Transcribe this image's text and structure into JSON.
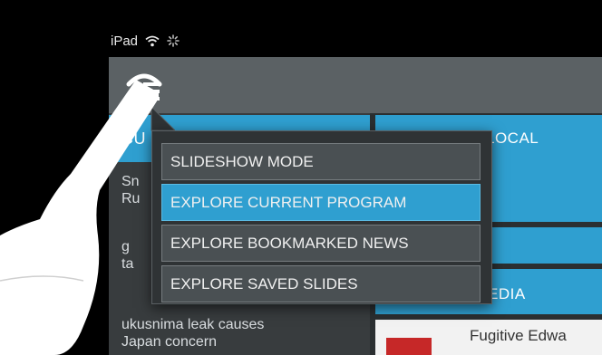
{
  "status_bar": {
    "device_label": "iPad",
    "icons": [
      "wifi-icon",
      "activity-spinner-icon"
    ]
  },
  "top_bar": {
    "menu_icon": "menu-icon"
  },
  "left_panel": {
    "tab_label": "CU",
    "news_items": [
      {
        "line1": "Sn",
        "line2": "Ru"
      },
      {
        "line1": "g",
        "line2": "ta"
      },
      {
        "line1": "ukusnima leak causes",
        "line2": "Japan concern"
      }
    ]
  },
  "right_panel": {
    "local_label": "LOCAL",
    "media_label": "EDIA",
    "media_item_title": "Fugitive Edwa"
  },
  "popup_menu": {
    "items": [
      {
        "label": "SLIDESHOW MODE",
        "active": false
      },
      {
        "label": "EXPLORE CURRENT PROGRAM",
        "active": true
      },
      {
        "label": "EXPLORE BOOKMARKED NEWS",
        "active": false
      },
      {
        "label": "EXPLORE SAVED SLIDES",
        "active": false
      }
    ]
  },
  "colors": {
    "accent": "#2f9fd0",
    "menu_bg": "#2f3335",
    "item_bg": "#4a5053",
    "top_bar": "#5b6164"
  }
}
